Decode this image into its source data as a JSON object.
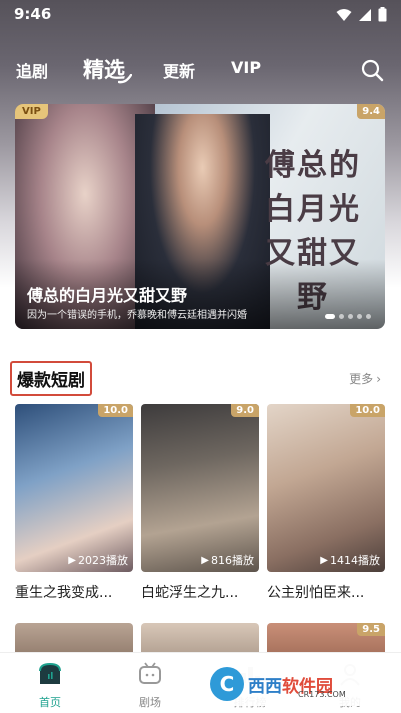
{
  "status_bar": {
    "time": "9:46"
  },
  "top_nav": {
    "tabs": [
      {
        "label": "追剧",
        "active": false
      },
      {
        "label": "精选",
        "active": true
      },
      {
        "label": "更新",
        "active": false
      },
      {
        "label": "VIP",
        "active": false
      }
    ]
  },
  "banner": {
    "badge": "VIP",
    "score": "9.4",
    "title": "傅总的白月光又甜又野",
    "description": "因为一个错误的手机，乔慕晚和傅云廷相遇并闪婚",
    "calligraphy": [
      "傅总的",
      "白月光",
      "又甜又野"
    ]
  },
  "section": {
    "title": "爆款短剧",
    "more_label": "更多"
  },
  "cards": [
    {
      "title": "重生之我变成...",
      "score": "10.0",
      "plays": "2023播放",
      "colors": [
        "#3a5f8a",
        "#9fb7d3",
        "#e9d4c7"
      ]
    },
    {
      "title": "白蛇浮生之九...",
      "score": "9.0",
      "plays": "816播放",
      "colors": [
        "#4d4a4a",
        "#8d8479",
        "#c9b8a3"
      ]
    },
    {
      "title": "公主别怕臣来...",
      "score": "10.0",
      "plays": "1414播放",
      "colors": [
        "#d9c7b8",
        "#a88b77",
        "#5a4a44"
      ]
    }
  ],
  "cards_row2": [
    {
      "score": ""
    },
    {
      "score": ""
    },
    {
      "score": "9.5"
    }
  ],
  "bottom_nav": [
    {
      "label": "首页",
      "active": true
    },
    {
      "label": "剧场",
      "active": false
    },
    {
      "label": "排行榜",
      "active": false
    },
    {
      "label": "我的",
      "active": false
    }
  ],
  "watermark": {
    "text_a": "西西",
    "text_b": "软件园",
    "domain": "CR173.COM"
  }
}
